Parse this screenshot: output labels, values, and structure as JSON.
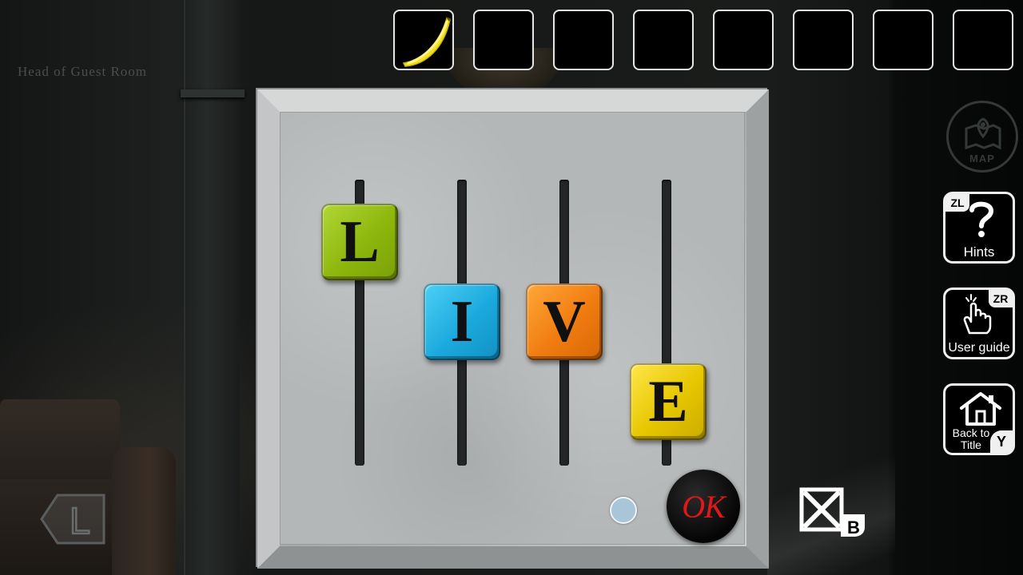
{
  "location": {
    "name": "Head of Guest Room"
  },
  "inventory": {
    "slots": [
      {
        "item": "banana-icon"
      },
      {
        "item": ""
      },
      {
        "item": ""
      },
      {
        "item": ""
      },
      {
        "item": ""
      },
      {
        "item": ""
      },
      {
        "item": ""
      },
      {
        "item": ""
      }
    ]
  },
  "puzzle": {
    "tiles": [
      {
        "letter": "L",
        "color": "#9ac81a",
        "position": 0.25
      },
      {
        "letter": "I",
        "color": "#1ba9dd",
        "position": 0.55
      },
      {
        "letter": "V",
        "color": "#f07c10",
        "position": 0.55
      },
      {
        "letter": "E",
        "color": "#e6c600",
        "position": 0.92
      }
    ],
    "ok_label": "OK",
    "ok_color": "#e01818"
  },
  "sidebar": {
    "map_label": "MAP",
    "hints": {
      "key": "ZL",
      "label": "Hints"
    },
    "user_guide": {
      "key": "ZR",
      "label": "User guide"
    },
    "back_to_title": {
      "key": "Y",
      "label_line1": "Back to",
      "label_line2": "Title"
    }
  },
  "controls": {
    "left_key": "L",
    "close_key": "B"
  }
}
